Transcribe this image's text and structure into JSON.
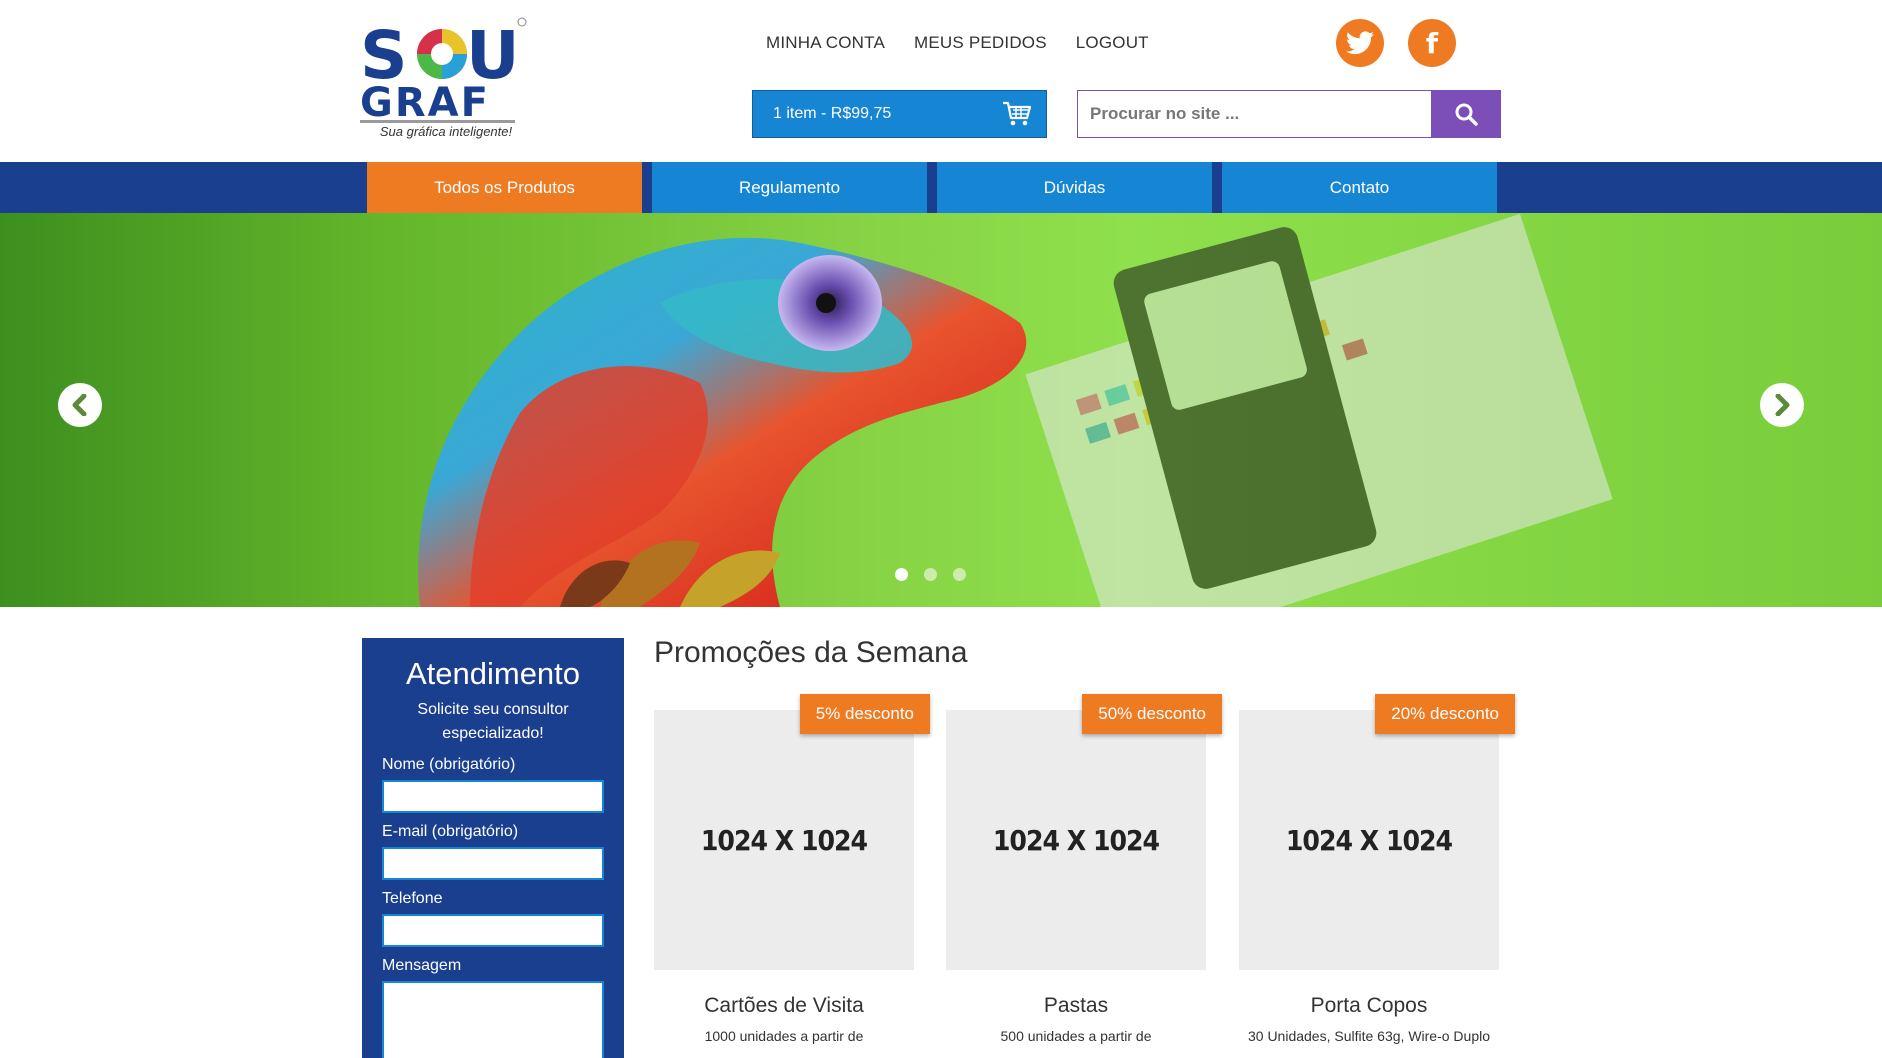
{
  "logo": {
    "line1": "SOU",
    "line2": "GRAF",
    "tagline": "Sua gráfica inteligente!"
  },
  "top_links": [
    "MINHA CONTA",
    "MEUS PEDIDOS",
    "LOGOUT"
  ],
  "social": {
    "twitter_icon": "twitter-icon",
    "facebook_icon": "facebook-icon",
    "facebook_glyph": "f"
  },
  "cart": {
    "label": "1 item - R$99,75",
    "icon": "cart-icon"
  },
  "search": {
    "placeholder": "Procurar no site ...",
    "icon": "search-icon"
  },
  "nav": [
    {
      "label": "Todos os Produtos",
      "active": true
    },
    {
      "label": "Regulamento"
    },
    {
      "label": "Dúvidas"
    },
    {
      "label": "Contato"
    }
  ],
  "hero": {
    "prev_icon": "chevron-left-icon",
    "next_icon": "chevron-right-icon",
    "slides": 3,
    "active_slide": 1
  },
  "sidebar": {
    "title": "Atendimento",
    "subtitle": "Solicite seu consultor especializado!",
    "fields": [
      "Nome (obrigatório)",
      "E-mail (obrigatório)",
      "Telefone",
      "Mensagem"
    ]
  },
  "promotions": {
    "title": "Promoções da Semana",
    "items": [
      {
        "badge": "5% desconto",
        "placeholder": "1024 X 1024",
        "name": "Cartões de Visita",
        "desc": "1000 unidades a partir de"
      },
      {
        "badge": "50% desconto",
        "placeholder": "1024 X 1024",
        "name": "Pastas",
        "desc": "500 unidades a partir de"
      },
      {
        "badge": "20% desconto",
        "placeholder": "1024 X 1024",
        "name": "Porta Copos",
        "desc": "30 Unidades, Sulfite 63g, Wire-o Duplo"
      }
    ]
  },
  "colors": {
    "brand_blue": "#1b3f8f",
    "nav_blue": "#1685d4",
    "orange": "#ee7a22",
    "purple": "#7c4fb8"
  }
}
